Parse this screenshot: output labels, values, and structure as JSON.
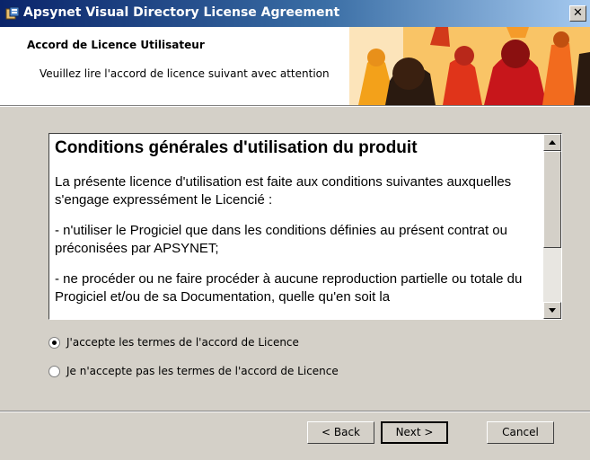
{
  "window": {
    "title": "Apsynet Visual Directory License Agreement",
    "close_symbol": "✕"
  },
  "header": {
    "title": "Accord de Licence Utilisateur",
    "subtitle": "Veuillez lire l'accord de licence suivant avec attention"
  },
  "license": {
    "heading": "Conditions générales d'utilisation du produit",
    "paragraphs": [
      "La présente licence d'utilisation est faite aux conditions suivantes auxquelles s'engage expressément le Licencié :",
      "- n'utiliser le Progiciel que dans les conditions définies au présent contrat ou préconisées par APSYNET;",
      "- ne procéder ou ne faire procéder à aucune reproduction partielle ou totale du Progiciel et/ou de sa Documentation, quelle qu'en soit la"
    ]
  },
  "options": {
    "accept_label": "J'accepte les termes de l'accord de Licence",
    "decline_label": "Je n'accepte pas les termes de l'accord de Licence",
    "selected": "accept"
  },
  "buttons": {
    "back": "< Back",
    "next": "Next >",
    "cancel": "Cancel"
  },
  "icons": {
    "app": "installer-icon",
    "close": "close-icon",
    "scroll_up": "arrow-up-icon",
    "scroll_down": "arrow-down-icon"
  },
  "colors": {
    "titlebar_start": "#0a246a",
    "titlebar_end": "#a6caf0",
    "dialog_face": "#d4d0c8",
    "banner_accent": "#f7a81b"
  }
}
